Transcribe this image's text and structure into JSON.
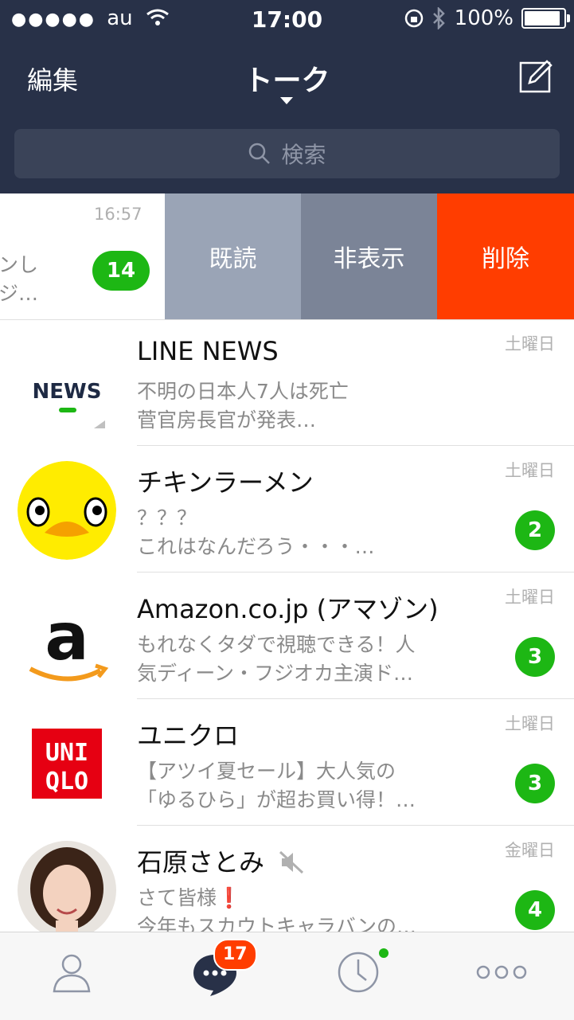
{
  "status_bar": {
    "signal": "●●●●●",
    "carrier": "au",
    "time": "17:00",
    "battery": "100%",
    "battery_level": 1.0
  },
  "nav": {
    "edit_label": "編集",
    "title": "トーク",
    "compose_icon": "compose-icon"
  },
  "search": {
    "placeholder": "検索"
  },
  "swiped_row": {
    "time": "16:57",
    "message_fragment": "ンし\nジ…",
    "badge": "14",
    "actions": {
      "read": "既読",
      "hide": "非表示",
      "delete": "削除"
    }
  },
  "chats": [
    {
      "name": "LINE NEWS",
      "message": "不明の日本人7人は死亡\n菅官房長官が発表…",
      "day": "土曜日",
      "badge": "",
      "avatar_text": "NEWS"
    },
    {
      "name": "チキンラーメン",
      "message": "？？？\nこれはなんだろう・・・…",
      "day": "土曜日",
      "badge": "2",
      "avatar_text": ""
    },
    {
      "name": "Amazon.co.jp (アマゾン)",
      "message": "もれなくタダで視聴できる！人\n気ディーン・フジオカ主演ド…",
      "day": "土曜日",
      "badge": "3",
      "avatar_text": "a"
    },
    {
      "name": "ユニクロ",
      "message": "【アツイ夏セール】大人気の\n「ゆるひら」が超お買い得！…",
      "day": "土曜日",
      "badge": "3",
      "avatar_text": "UNI\nQLO"
    },
    {
      "name": "石原さとみ",
      "message": "さて皆様❗\n今年もスカウトキャラバンの…",
      "day": "金曜日",
      "badge": "4",
      "avatar_text": ""
    }
  ],
  "tabbar": {
    "chat_badge": "17",
    "tabs": [
      "friends-icon",
      "chat-icon",
      "timeline-icon",
      "more-icon"
    ]
  },
  "colors": {
    "nav_bg": "#283148",
    "badge_green": "#1db714",
    "delete_red": "#ff3d00"
  }
}
